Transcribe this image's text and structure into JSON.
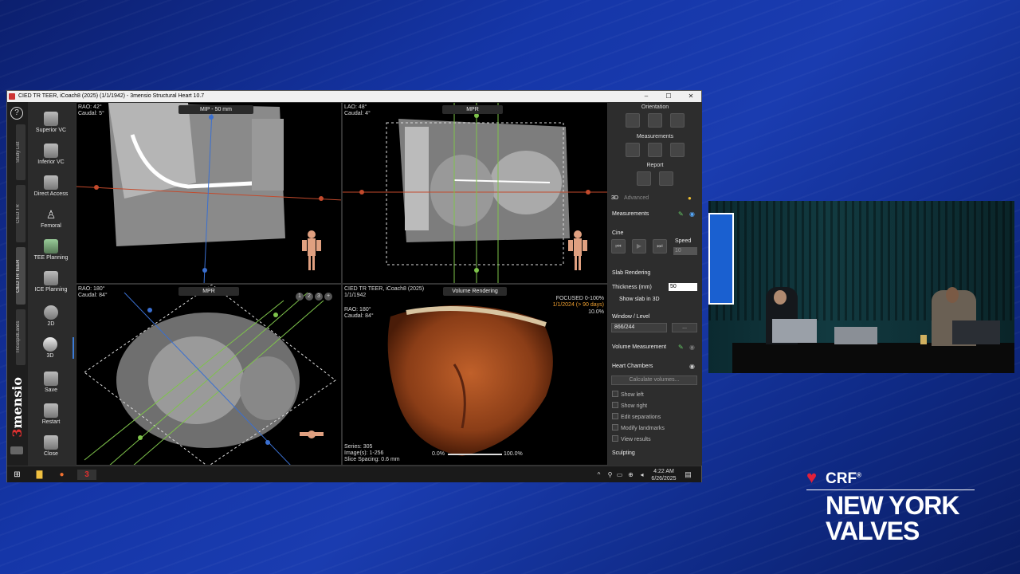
{
  "window": {
    "title": "CIED TR TEER, iCoach8 (2025) (1/1/1942) - 3mensio Structural Heart 10.7",
    "min": "–",
    "max": "☐",
    "close": "✕"
  },
  "vtabs": [
    "Study List",
    "CIED TR",
    "CIED TR TEER",
    "TricuspidLands"
  ],
  "help": "?",
  "logo": {
    "three": "3",
    "rest": "mensio"
  },
  "tools": [
    {
      "label": "Superior VC"
    },
    {
      "label": "Inferior VC"
    },
    {
      "label": "Direct Access"
    },
    {
      "label": "Femoral"
    },
    {
      "label": "TEE Planning"
    },
    {
      "label": "ICE Planning"
    },
    {
      "label": "2D"
    },
    {
      "label": "3D"
    },
    {
      "label": "Save"
    },
    {
      "label": "Restart"
    },
    {
      "label": "Close"
    }
  ],
  "vp1": {
    "angle1": "RAO: 42°",
    "angle2": "Caudal: 5°",
    "mode": "MIP - 50 mm"
  },
  "vp2": {
    "angle1": "LAO: 48°",
    "angle2": "Caudal: 4°",
    "mode": "MPR"
  },
  "vp3": {
    "angle1": "RAO: 180°",
    "angle2": "Caudal: 84°",
    "mode": "MPR",
    "nums": [
      "1",
      "2",
      "3",
      "+"
    ]
  },
  "vp4": {
    "study": "CIED TR TEER, iCoach8 (2025)",
    "date": "1/1/1942",
    "angle1": "RAO: 180°",
    "angle2": "Caudal: 84°",
    "mode": "Volume Rendering",
    "focused": "FOCUSED 0-100%",
    "focused_date": "1/1/2024 (> 90 days)",
    "pct": "10.0%",
    "series": "Series: 305",
    "images": "Image(s): 1-256",
    "spacing": "Slice Spacing: 0.6 mm",
    "bar_min": "0.0%",
    "bar_max": "100.0%"
  },
  "panel": {
    "orientation": "Orientation",
    "measurements_h": "Measurements",
    "report": "Report",
    "tab3d": "3D",
    "tabadv": "Advanced",
    "measurements": "Measurements",
    "cine": "Cine",
    "speed": "Speed",
    "speed_val": "10",
    "slab": "Slab Rendering",
    "thickness": "Thickness (mm)",
    "thickness_val": "50",
    "show_slab": "Show slab in 3D",
    "wl": "Window / Level",
    "wl_val": "866/244",
    "wl_btn": "...",
    "vol_meas": "Volume Measurement",
    "heart_chambers": "Heart Chambers",
    "calc": "Calculate volumes...",
    "checks": [
      "Show left",
      "Show right",
      "Edit separations",
      "Modify landmarks",
      "View results"
    ],
    "sculpting": "Sculpting"
  },
  "taskbar": {
    "time": "4:22 AM",
    "date": "6/26/2025"
  },
  "brand": {
    "crf": "CRF",
    "reg": "®",
    "line1": "NEW YORK",
    "line2": "VALVES"
  }
}
